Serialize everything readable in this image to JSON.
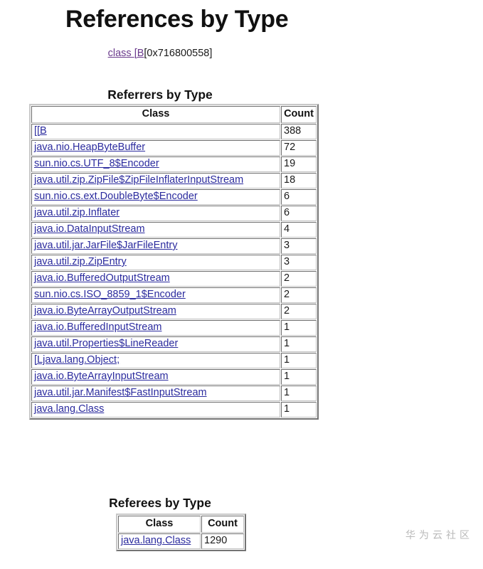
{
  "page": {
    "title": "References by Type",
    "subject": {
      "kind_link": "class ",
      "name_link": "[B",
      "address": "[0x716800558]"
    },
    "watermark": "华为云社区"
  },
  "referrers": {
    "heading": "Referrers by Type",
    "columns": {
      "class": "Class",
      "count": "Count"
    },
    "rows": [
      {
        "class": "[[B",
        "count": "388"
      },
      {
        "class": "java.nio.HeapByteBuffer",
        "count": "72"
      },
      {
        "class": "sun.nio.cs.UTF_8$Encoder",
        "count": "19"
      },
      {
        "class": "java.util.zip.ZipFile$ZipFileInflaterInputStream",
        "count": "18"
      },
      {
        "class": "sun.nio.cs.ext.DoubleByte$Encoder",
        "count": "6"
      },
      {
        "class": "java.util.zip.Inflater",
        "count": "6"
      },
      {
        "class": "java.io.DataInputStream",
        "count": "4"
      },
      {
        "class": "java.util.jar.JarFile$JarFileEntry",
        "count": "3"
      },
      {
        "class": "java.util.zip.ZipEntry",
        "count": "3"
      },
      {
        "class": "java.io.BufferedOutputStream",
        "count": "2"
      },
      {
        "class": "sun.nio.cs.ISO_8859_1$Encoder",
        "count": "2"
      },
      {
        "class": "java.io.ByteArrayOutputStream",
        "count": "2"
      },
      {
        "class": "java.io.BufferedInputStream",
        "count": "1"
      },
      {
        "class": "java.util.Properties$LineReader",
        "count": "1"
      },
      {
        "class": "[Ljava.lang.Object;",
        "count": "1"
      },
      {
        "class": "java.io.ByteArrayInputStream",
        "count": "1"
      },
      {
        "class": "java.util.jar.Manifest$FastInputStream",
        "count": "1"
      },
      {
        "class": "java.lang.Class",
        "count": "1"
      }
    ]
  },
  "referees": {
    "heading": "Referees by Type",
    "columns": {
      "class": "Class",
      "count": "Count"
    },
    "rows": [
      {
        "class": "java.lang.Class",
        "count": "1290"
      }
    ]
  }
}
